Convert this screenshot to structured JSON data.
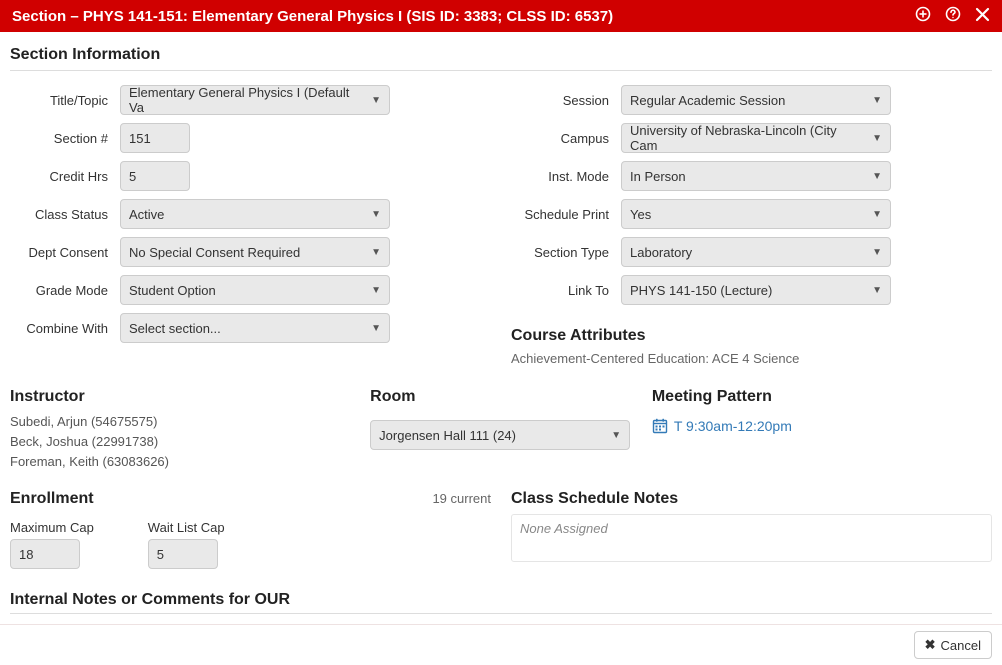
{
  "titlebar": {
    "title": "Section – PHYS 141-151: Elementary General Physics I (SIS ID: 3383; CLSS ID: 6537)"
  },
  "headings": {
    "section_info": "Section Information",
    "course_attributes": "Course Attributes",
    "instructor": "Instructor",
    "room": "Room",
    "meeting_pattern": "Meeting Pattern",
    "enrollment": "Enrollment",
    "class_schedule_notes": "Class Schedule Notes",
    "internal_notes": "Internal Notes or Comments for OUR"
  },
  "left_fields": {
    "title_topic": {
      "label": "Title/Topic",
      "value": "Elementary General Physics I (Default Va"
    },
    "section_num": {
      "label": "Section #",
      "value": "151"
    },
    "credit_hrs": {
      "label": "Credit Hrs",
      "value": "5"
    },
    "class_status": {
      "label": "Class Status",
      "value": "Active"
    },
    "dept_consent": {
      "label": "Dept Consent",
      "value": "No Special Consent Required"
    },
    "grade_mode": {
      "label": "Grade Mode",
      "value": "Student Option"
    },
    "combine_with": {
      "label": "Combine With",
      "value": "Select section..."
    }
  },
  "right_fields": {
    "session": {
      "label": "Session",
      "value": "Regular Academic Session"
    },
    "campus": {
      "label": "Campus",
      "value": "University of Nebraska-Lincoln (City Cam"
    },
    "inst_mode": {
      "label": "Inst. Mode",
      "value": "In Person"
    },
    "schedule_print": {
      "label": "Schedule Print",
      "value": "Yes"
    },
    "section_type": {
      "label": "Section Type",
      "value": "Laboratory"
    },
    "link_to": {
      "label": "Link To",
      "value": "PHYS 141-150 (Lecture)"
    }
  },
  "course_attributes_text": "Achievement-Centered Education: ACE 4 Science",
  "instructors": [
    "Subedi, Arjun (54675575)",
    "Beck, Joshua (22991738)",
    "Foreman, Keith (63083626)"
  ],
  "room": {
    "value": "Jorgensen Hall 111 (24)"
  },
  "meeting_pattern": {
    "text": "T 9:30am-12:20pm"
  },
  "enrollment": {
    "current_text": "19 current",
    "max_cap_label": "Maximum Cap",
    "max_cap_value": "18",
    "wait_cap_label": "Wait List Cap",
    "wait_cap_value": "5"
  },
  "class_schedule_notes": {
    "placeholder": "None Assigned"
  },
  "footer": {
    "cancel": "Cancel"
  }
}
